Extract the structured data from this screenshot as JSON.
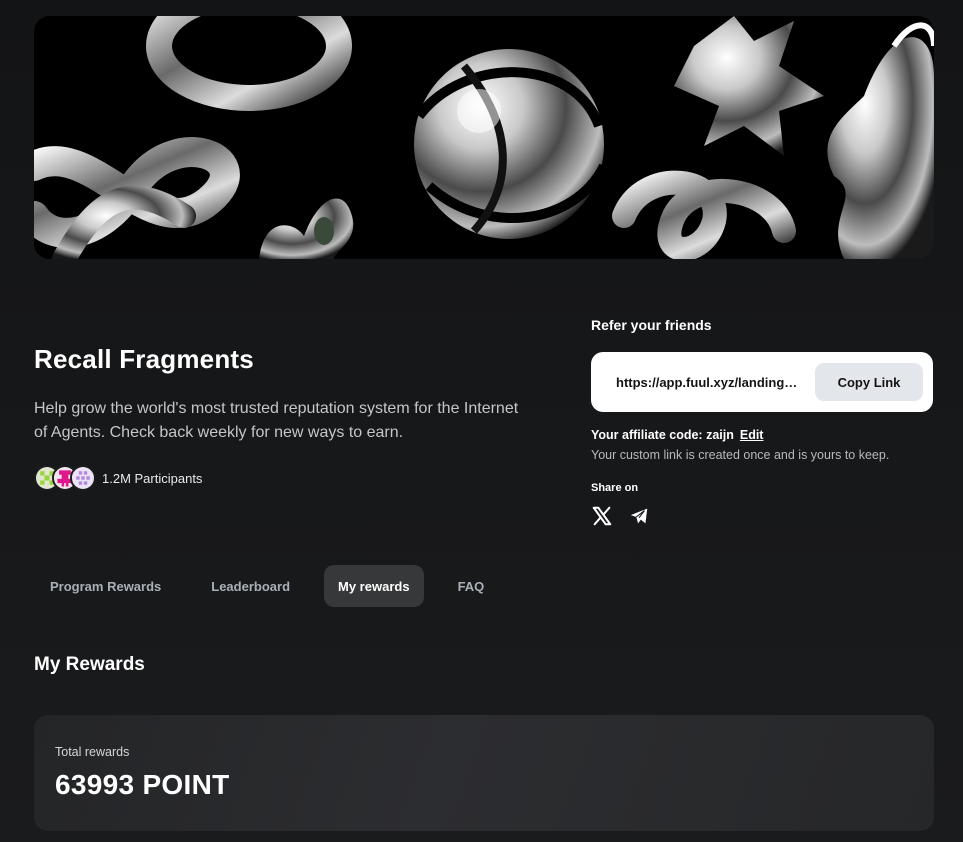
{
  "banner": {
    "image": "chrome-3d-shapes-banner"
  },
  "program": {
    "title": "Recall Fragments",
    "description": "Help grow the world's most trusted reputation system for the Internet of Agents. Check back weekly for new ways to earn.",
    "participants_text": "1.2M Participants",
    "avatar_colors": [
      "#9ad43a",
      "#e0178a",
      "#c7a7e8"
    ]
  },
  "refer": {
    "title": "Refer your friends",
    "link": "https://app.fuul.xyz/landing/recall?referrer=zaijn",
    "copy_label": "Copy Link",
    "affiliate_label": "Your affiliate code: zaijn",
    "edit_label": "Edit",
    "custom_note": "Your custom link is created once and is yours to keep.",
    "share_label": "Share on",
    "share_icons": [
      "x-icon",
      "telegram-icon"
    ]
  },
  "tabs": [
    {
      "label": "Program Rewards",
      "active": false
    },
    {
      "label": "Leaderboard",
      "active": false
    },
    {
      "label": "My rewards",
      "active": true
    },
    {
      "label": "FAQ",
      "active": false
    }
  ],
  "rewards": {
    "heading": "My Rewards",
    "total_label": "Total rewards",
    "total_value": "63993 POINT"
  }
}
